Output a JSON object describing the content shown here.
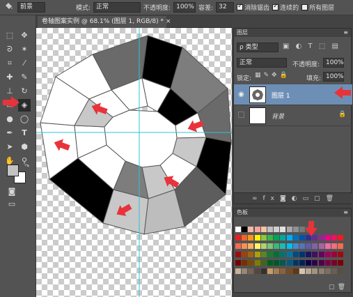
{
  "options": {
    "preset": "前景",
    "mode_label": "模式:",
    "mode_value": "正常",
    "opacity_label": "不透明度:",
    "opacity_value": "100%",
    "tolerance_label": "容差:",
    "tolerance_value": "32",
    "antialias_label": "消除锯齿",
    "contiguous_label": "连续的",
    "all_layers_label": "所有图层"
  },
  "document": {
    "tab_title": "卷轴图案实例 @ 68.1% (图层 1, RGB/8) *"
  },
  "layers_panel": {
    "title": "图层",
    "filter_label": "ρ 类型",
    "blend_mode": "正常",
    "opacity_label": "不透明度:",
    "opacity_value": "100%",
    "lock_label": "锁定:",
    "fill_label": "填充:",
    "fill_value": "100%",
    "layers": [
      {
        "name": "图层 1",
        "selected": true
      },
      {
        "name": "背景",
        "selected": false
      }
    ],
    "footer_icons": [
      "link-icon",
      "fx-icon",
      "mask-icon",
      "adjustment-icon",
      "folder-icon",
      "new-layer-icon",
      "trash-icon"
    ]
  },
  "swatches_panel": {
    "title": "色板",
    "row1": [
      "#ffffff",
      "#000000",
      "#f2b8a8",
      "#f5a3a3",
      "#f7c3a0",
      "#c0c0c0",
      "#d0d0d0",
      "#e0e0e0",
      "#a8a8a8",
      "#909090",
      "#787878",
      "#606060"
    ],
    "rows": [
      [
        "#ed1c24",
        "#f26522",
        "#f7941d",
        "#fff200",
        "#8dc63f",
        "#39b54a",
        "#00a651",
        "#00a99d",
        "#00aeef",
        "#0072bc",
        "#0054a6",
        "#2e3192",
        "#662d91",
        "#92278f",
        "#ec008c",
        "#ed145b",
        "#ed1c24"
      ],
      [
        "#f26c4f",
        "#f68e55",
        "#fbaf5c",
        "#fff467",
        "#acd372",
        "#7cc576",
        "#3bb878",
        "#1abbb4",
        "#00bff3",
        "#438ccb",
        "#5574b9",
        "#605ca8",
        "#855fa8",
        "#a763a8",
        "#f06ea9",
        "#f26d7d",
        "#f26c4f"
      ],
      [
        "#9e0b0f",
        "#a0410d",
        "#a3620a",
        "#aba000",
        "#598527",
        "#1a7b30",
        "#007236",
        "#00746b",
        "#0076a3",
        "#004b80",
        "#003471",
        "#1b1464",
        "#440e62",
        "#630460",
        "#9e005d",
        "#9e0039",
        "#9e0b0f"
      ],
      [
        "#790000",
        "#7b2e00",
        "#7d4900",
        "#827b00",
        "#406618",
        "#005e20",
        "#005826",
        "#005952",
        "#005b7f",
        "#003663",
        "#002157",
        "#0d004c",
        "#32004b",
        "#4b0049",
        "#7b0046",
        "#7a0026",
        "#790000"
      ],
      [
        "#c7b299",
        "#998675",
        "#736357",
        "#534741",
        "#37302d",
        "#c69c6d",
        "#a67c52",
        "#8c6239",
        "#754c24",
        "#603913",
        "#d6c4b1",
        "#b7a692",
        "#a39382",
        "#8f8070",
        "#7c6e60",
        "#6b5e51",
        "#5a4e43"
      ]
    ]
  },
  "colors": {
    "ui_bg": "#535353",
    "panel_dark": "#424242",
    "selection_blue": "#6e8fb5",
    "arrow_red": "#e8333a",
    "guide_cyan": "#2ec4d6"
  }
}
